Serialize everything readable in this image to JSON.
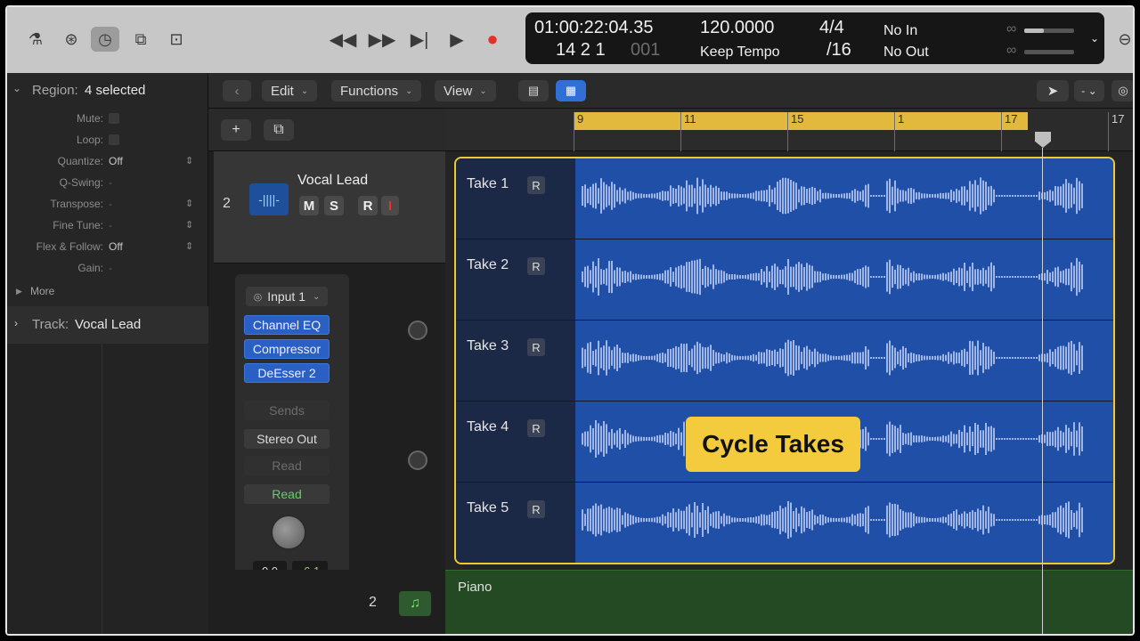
{
  "control_bar": {
    "timecode": "01:00:22:04.35",
    "bars_beats": "14  2  1",
    "bars_beats_dim": "001",
    "tempo": "120.0000",
    "tempo_mode": "Keep Tempo",
    "time_signature": "4/4",
    "division": "/16",
    "in_label": "No In",
    "out_label": "No Out",
    "icons": [
      "library-icon",
      "toolbar-icon",
      "smart-controls-icon",
      "mixer-icon",
      "editors-icon"
    ],
    "transport": [
      "rewind-icon",
      "fast-forward-icon",
      "go-to-end-icon",
      "play-icon",
      "record-icon"
    ]
  },
  "inspector": {
    "region_label": "Region:",
    "region_value": "4 selected",
    "params": [
      {
        "label": "Mute:",
        "value": ""
      },
      {
        "label": "Loop:",
        "value": ""
      },
      {
        "label": "Quantize:",
        "value": "Off"
      },
      {
        "label": "Q-Swing:",
        "value": "-"
      },
      {
        "label": "Transpose:",
        "value": "-"
      },
      {
        "label": "Fine Tune:",
        "value": "-"
      },
      {
        "label": "Flex & Follow:",
        "value": "Off"
      },
      {
        "label": "Gain:",
        "value": "-"
      }
    ],
    "more_label": "More",
    "track_label": "Track:",
    "track_value": "Vocal Lead"
  },
  "toolbar": {
    "edit": "Edit",
    "functions": "Functions",
    "view": "View"
  },
  "track": {
    "number": "2",
    "name": "Vocal Lead",
    "mute": "M",
    "solo": "S",
    "read": "R",
    "input": "I"
  },
  "channel_strip": {
    "input": "Input 1",
    "plugins": [
      "Channel EQ",
      "Compressor",
      "DeEsser 2"
    ],
    "sends": "Sends",
    "output": "Stereo Out",
    "automation_dim": "Read",
    "automation": "Read",
    "volume": "0.0",
    "peak": "-6.1"
  },
  "piano_track": {
    "number": "2",
    "name": "Piano"
  },
  "ruler": {
    "bars": [
      "9",
      "11",
      "15",
      "1",
      "17",
      "17"
    ]
  },
  "takes": [
    {
      "name": "Take 1",
      "r": "R"
    },
    {
      "name": "Take 2",
      "r": "R"
    },
    {
      "name": "Take 3",
      "r": "R"
    },
    {
      "name": "Take 4",
      "r": "R"
    },
    {
      "name": "Take 5",
      "r": "R"
    }
  ],
  "badge": "Cycle Takes",
  "colors": {
    "cycle": "#e2b93d",
    "region_blue": "#1f4fa6",
    "take_frame": "#f0c832",
    "badge": "#f4cb3c",
    "piano_green": "#234a23"
  }
}
